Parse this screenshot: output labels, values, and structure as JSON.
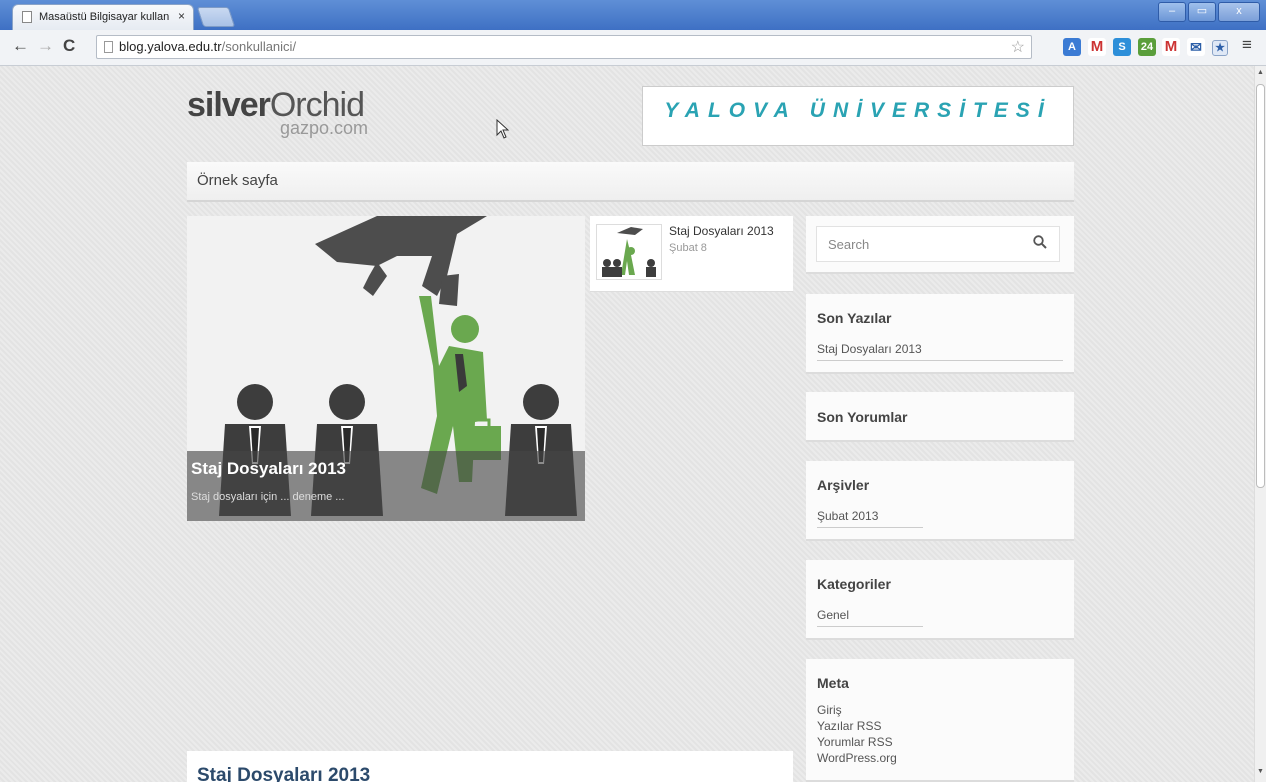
{
  "browser": {
    "tab_title": "Masaüstü Bilgisayar kullan",
    "tab_close": "×",
    "url_host": "blog.yalova.edu.tr",
    "url_path": "/sonkullanici/",
    "nav_back": "←",
    "nav_forward": "→",
    "nav_reload": "C",
    "bookmark_star": "☆",
    "menu": "≡",
    "win_min": "–",
    "win_max": "▭",
    "win_close": "x"
  },
  "site": {
    "logo_bold": "silver",
    "logo_rest": "Orchid",
    "logo_sub": "gazpo.com",
    "banner": "YALOVA ÜNİVERSİTESİ",
    "menu_item": "Örnek sayfa"
  },
  "featured": {
    "title": "Staj Dosyaları 2013",
    "excerpt": "Staj dosyaları için ... deneme ..."
  },
  "post_list": [
    {
      "title": "Staj Dosyaları 2013",
      "date": "Şubat 8"
    }
  ],
  "sidebar": {
    "search_placeholder": "Search",
    "recent_posts": {
      "heading": "Son Yazılar",
      "items": [
        "Staj Dosyaları 2013"
      ]
    },
    "recent_comments": {
      "heading": "Son Yorumlar"
    },
    "archives": {
      "heading": "Arşivler",
      "items": [
        "Şubat 2013"
      ]
    },
    "categories": {
      "heading": "Kategoriler",
      "items": [
        "Genel"
      ]
    },
    "meta": {
      "heading": "Meta",
      "items": [
        "Giriş",
        "Yazılar RSS",
        "Yorumlar RSS",
        "WordPress.org"
      ]
    }
  },
  "main_post": {
    "title": "Staj Dosyaları 2013"
  },
  "colors": {
    "banner_text": "#2aa3b3",
    "accent_green": "#6aa84f",
    "title_bar": "#3e70c4"
  }
}
